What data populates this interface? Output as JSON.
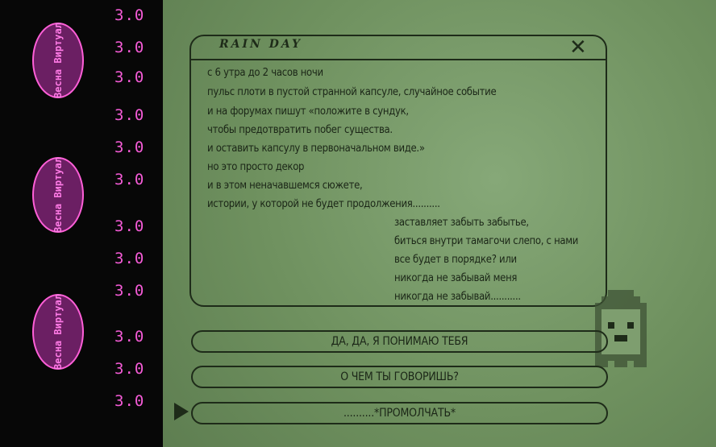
{
  "sidebar": {
    "numbers": [
      "3.0",
      "3.0",
      "3.0",
      "3.0",
      "3.0",
      "3.0",
      "3.0",
      "3.0",
      "3.0",
      "3.0",
      "3.0",
      "3.0"
    ],
    "badges": [
      "Весна Виртуал",
      "Весна Виртуал",
      "Весна Виртуал"
    ],
    "badge_color": "#ff5fd8",
    "number_color": "#f45bd6"
  },
  "dialog": {
    "title": "RAIN DAY",
    "close_label": "✕",
    "lines": [
      "с 6 утра до 2 часов ночи",
      "пульс плоти в пустой странной капсуле, случайное событие",
      "и на форумах пишут «положите в сундук,",
      "чтобы предотвратить побег существа.",
      "и оставить капсулу в первоначальном виде.»",
      "но это просто декор",
      "и в этом неначавшемся сюжете,",
      "истории, у которой не будет продолжения..........",
      "заставляет забыть забытье,",
      "биться внутри тамагочи слепо, с нами",
      "все будет в порядке? или",
      "никогда не забывай меня",
      "никогда не забывай..........."
    ]
  },
  "choices": [
    "ДА, ДА, Я ПОНИМАЮ ТЕБЯ",
    "О ЧЕМ ТЫ ГОВОРИШЬ?",
    "..........*ПРОМОЛЧАТЬ*"
  ],
  "colors": {
    "panel": "#769a67",
    "ink": "#1e2b19",
    "strip": "#070707"
  }
}
